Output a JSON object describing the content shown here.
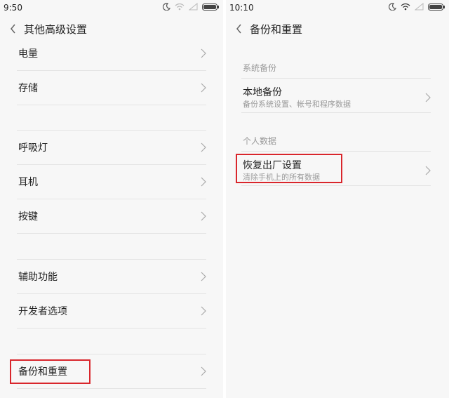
{
  "left": {
    "status_time": "9:50",
    "title": "其他高级设置",
    "rows": [
      {
        "label": "电量"
      },
      {
        "label": "存储"
      },
      {
        "label": "呼吸灯"
      },
      {
        "label": "耳机"
      },
      {
        "label": "按键"
      },
      {
        "label": "辅助功能"
      },
      {
        "label": "开发者选项"
      },
      {
        "label": "备份和重置"
      }
    ]
  },
  "right": {
    "status_time": "10:10",
    "title": "备份和重置",
    "section_system": "系统备份",
    "local_backup_title": "本地备份",
    "local_backup_sub": "备份系统设置、帐号和程序数据",
    "section_personal": "个人数据",
    "factory_reset_title": "恢复出厂设置",
    "factory_reset_sub": "清除手机上的所有数据"
  },
  "colors": {
    "highlight": "#d9262c",
    "background": "#f7f7f7",
    "divider": "#e4e4e4"
  }
}
